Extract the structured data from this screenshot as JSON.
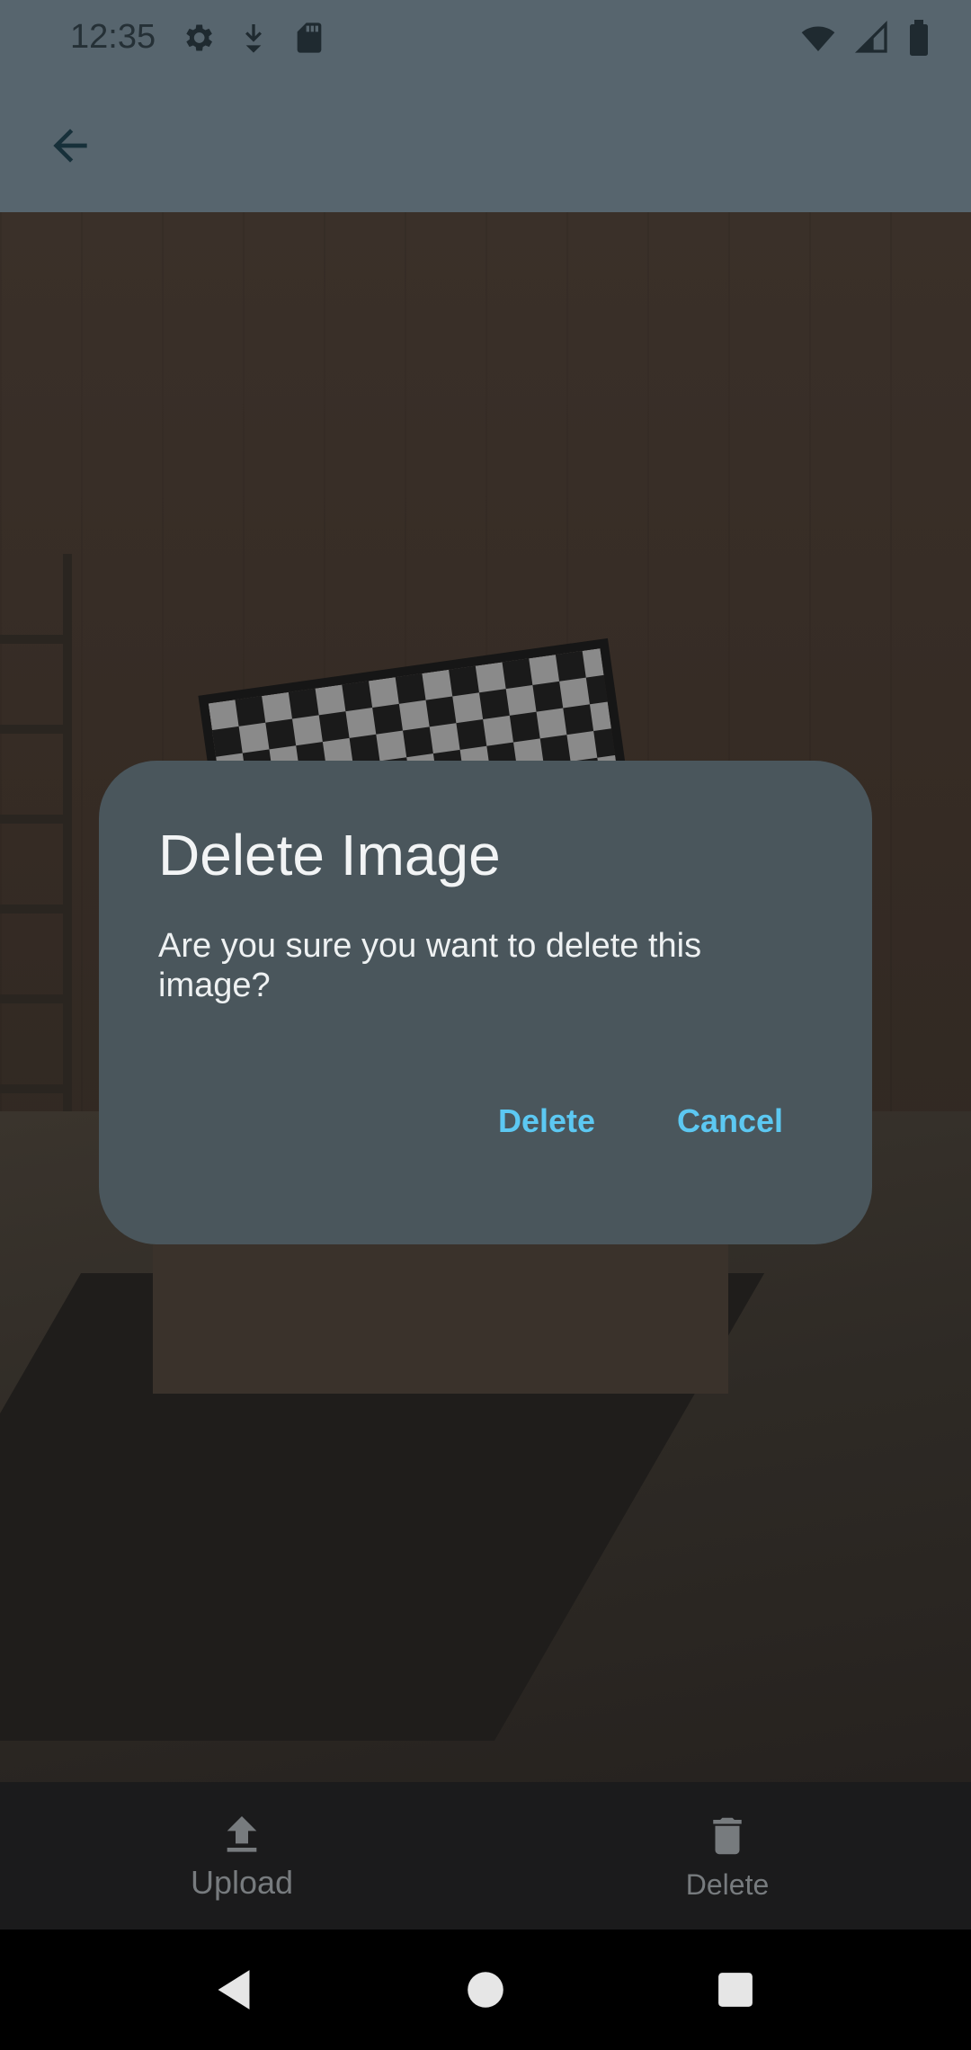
{
  "status_bar": {
    "time": "12:35",
    "left_icons": [
      "settings-icon",
      "download-icon",
      "sd-card-icon"
    ],
    "right_icons": [
      "wifi-icon",
      "cell-signal-icon",
      "battery-icon"
    ]
  },
  "app_bar": {
    "back_icon": "arrow-back-icon"
  },
  "dialog": {
    "title": "Delete Image",
    "message": "Are you sure you want to delete this image?",
    "confirm_label": "Delete",
    "cancel_label": "Cancel",
    "accent_color": "#5cc8f2"
  },
  "bottom_nav": {
    "items": [
      {
        "label": "Upload",
        "icon": "upload-icon"
      },
      {
        "label": "Delete",
        "icon": "trash-icon"
      }
    ]
  },
  "system_nav": {
    "keys": [
      "back-triangle-icon",
      "home-circle-icon",
      "recents-square-icon"
    ]
  }
}
